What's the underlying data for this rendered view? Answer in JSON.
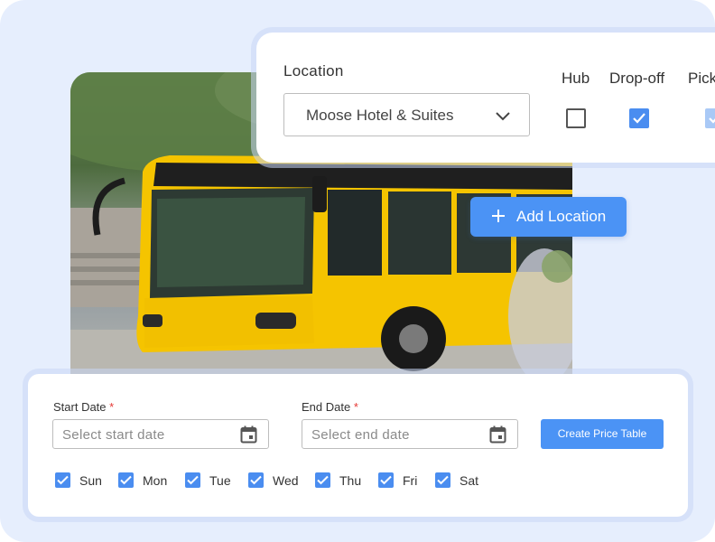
{
  "location": {
    "label": "Location",
    "selected": "Moose Hotel & Suites",
    "columns": [
      {
        "label": "Hub",
        "checked": false
      },
      {
        "label": "Drop-off",
        "checked": true
      },
      {
        "label": "Pick",
        "checked": true
      }
    ]
  },
  "add_location": {
    "label": "Add Location"
  },
  "dates": {
    "start_label": "Start Date",
    "start_placeholder": "Select start date",
    "end_label": "End Date",
    "end_placeholder": "Select end date",
    "required_mark": "*",
    "create_button": "Create Price Table"
  },
  "days": [
    {
      "label": "Sun",
      "checked": true
    },
    {
      "label": "Mon",
      "checked": true
    },
    {
      "label": "Tue",
      "checked": true
    },
    {
      "label": "Wed",
      "checked": true
    },
    {
      "label": "Thu",
      "checked": true
    },
    {
      "label": "Fri",
      "checked": true
    },
    {
      "label": "Sat",
      "checked": true
    }
  ],
  "colors": {
    "background": "#e6eefd",
    "accent": "#4b93f5",
    "required": "#e53935",
    "bus_yellow": "#f5c400"
  }
}
